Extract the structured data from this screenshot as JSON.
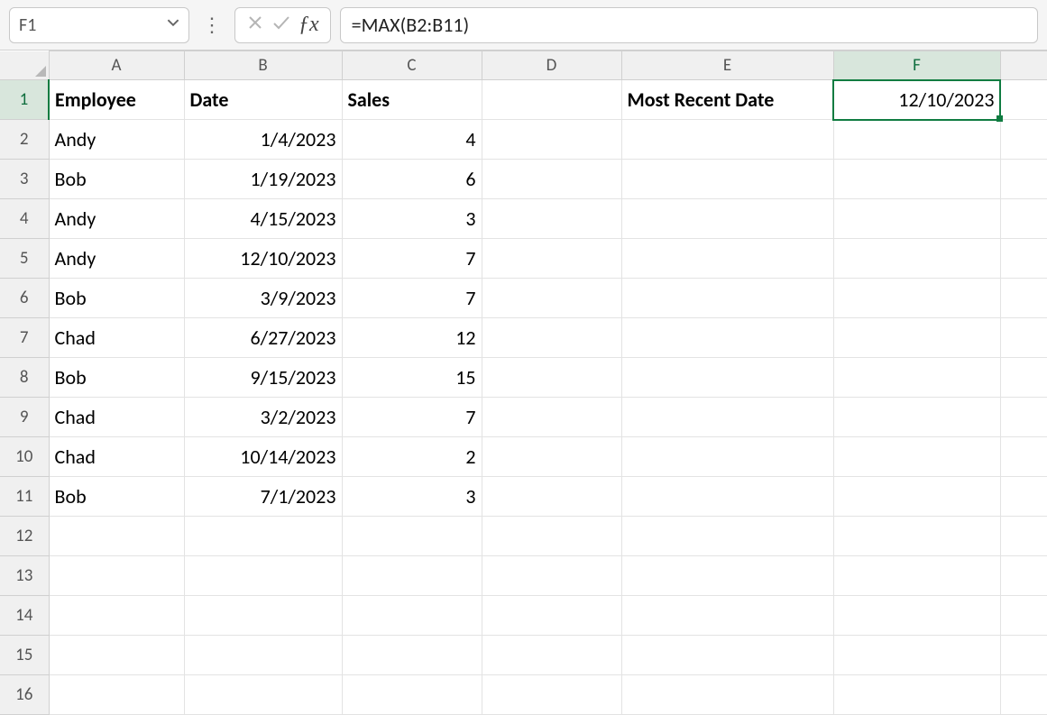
{
  "formula_bar": {
    "name_box_value": "F1",
    "formula_text": "=MAX(B2:B11)"
  },
  "columns": [
    "A",
    "B",
    "C",
    "D",
    "E",
    "F"
  ],
  "active_column": "F",
  "active_row": "1",
  "selected_cell": "F1",
  "headers": {
    "A1": "Employee",
    "B1": "Date",
    "C1": "Sales",
    "E1": "Most Recent Date",
    "F1": "12/10/2023"
  },
  "rows": [
    {
      "n": "2",
      "employee": "Andy",
      "date": "1/4/2023",
      "sales": "4"
    },
    {
      "n": "3",
      "employee": "Bob",
      "date": "1/19/2023",
      "sales": "6"
    },
    {
      "n": "4",
      "employee": "Andy",
      "date": "4/15/2023",
      "sales": "3"
    },
    {
      "n": "5",
      "employee": "Andy",
      "date": "12/10/2023",
      "sales": "7"
    },
    {
      "n": "6",
      "employee": "Bob",
      "date": "3/9/2023",
      "sales": "7"
    },
    {
      "n": "7",
      "employee": "Chad",
      "date": "6/27/2023",
      "sales": "12"
    },
    {
      "n": "8",
      "employee": "Bob",
      "date": "9/15/2023",
      "sales": "15"
    },
    {
      "n": "9",
      "employee": "Chad",
      "date": "3/2/2023",
      "sales": "7"
    },
    {
      "n": "10",
      "employee": "Chad",
      "date": "10/14/2023",
      "sales": "2"
    },
    {
      "n": "11",
      "employee": "Bob",
      "date": "7/1/2023",
      "sales": "3"
    }
  ],
  "empty_rows": [
    "12",
    "13",
    "14",
    "15",
    "16"
  ]
}
